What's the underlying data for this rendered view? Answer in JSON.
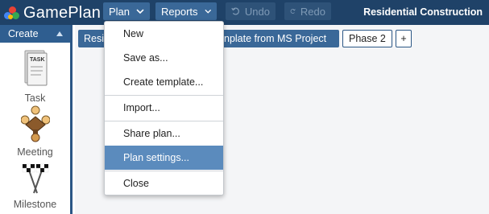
{
  "app": {
    "logo_text": "GamePlan",
    "logo_colors": [
      "#e94235",
      "#4285f4",
      "#34a853",
      "#fbbc05"
    ]
  },
  "topbar": {
    "plan_label": "Plan",
    "reports_label": "Reports",
    "undo_label": "Undo",
    "redo_label": "Redo",
    "project_title": "Residential Construction"
  },
  "sidebar": {
    "header_label": "Create",
    "tools": [
      {
        "label": "Task",
        "icon": "task-icon"
      },
      {
        "label": "Meeting",
        "icon": "meeting-icon"
      },
      {
        "label": "Milestone",
        "icon": "milestone-icon"
      }
    ]
  },
  "main": {
    "tabs": {
      "active_left": "Resi",
      "active_right": "nplate from MS Project",
      "phase2": "Phase 2",
      "add": "+"
    }
  },
  "plan_menu": {
    "items": [
      "New",
      "Save as...",
      "Create template...",
      "Import...",
      "Share plan...",
      "Plan settings...",
      "Close"
    ],
    "highlighted": "Plan settings..."
  },
  "colors": {
    "topbar": "#1f4268",
    "button": "#3a6898",
    "highlight": "#5b8bbd",
    "sidebar_border": "#2c5786"
  }
}
